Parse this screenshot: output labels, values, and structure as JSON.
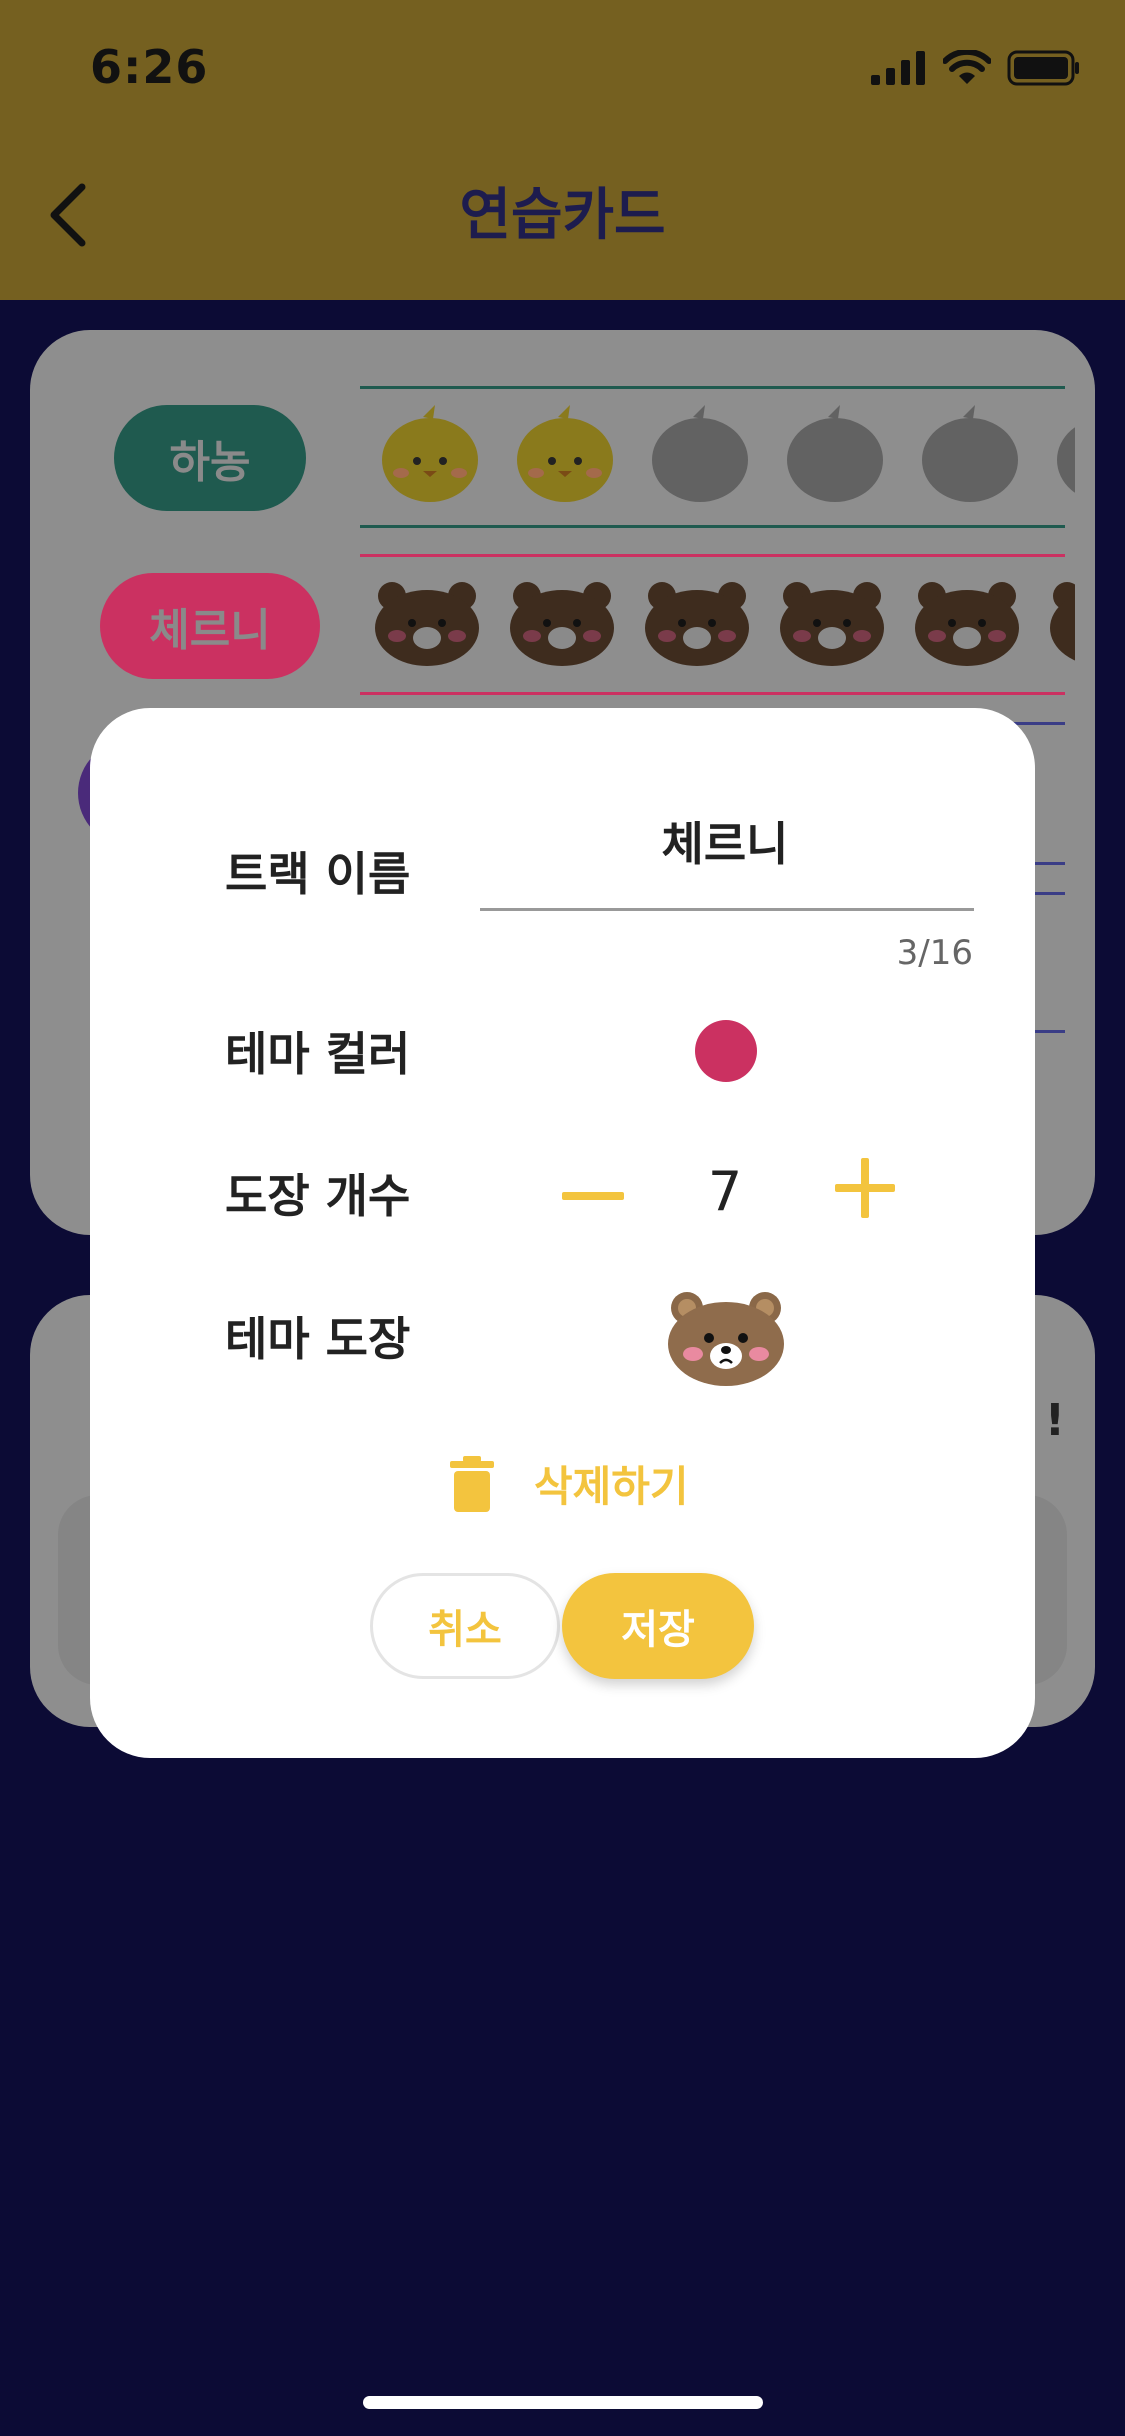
{
  "status_bar": {
    "time": "6:26"
  },
  "header": {
    "title": "연습카드"
  },
  "background": {
    "tracks": [
      {
        "name": "하농",
        "pill_color": "#1f5a4f",
        "line_color": "#1f5a4f",
        "stamp": "chick",
        "filled": 2,
        "total": 6
      },
      {
        "name": "체르니",
        "pill_color": "#cb3161",
        "line_color": "#cb3161",
        "stamp": "bear",
        "filled": 6,
        "total": 6
      }
    ],
    "card2_partial_text": "!"
  },
  "modal": {
    "track_name_label": "트랙 이름",
    "track_name_value": "체르니",
    "char_counter": "3/16",
    "theme_color_label": "테마 컬러",
    "theme_color": "#cb3161",
    "stamp_count_label": "도장 개수",
    "stamp_count": "7",
    "theme_stamp_label": "테마 도장",
    "theme_stamp_icon": "bear-face-icon",
    "delete_label": "삭제하기",
    "cancel_label": "취소",
    "save_label": "저장"
  },
  "colors": {
    "accent": "#f3c43e",
    "header": "#756020",
    "background": "#0c0b35"
  }
}
